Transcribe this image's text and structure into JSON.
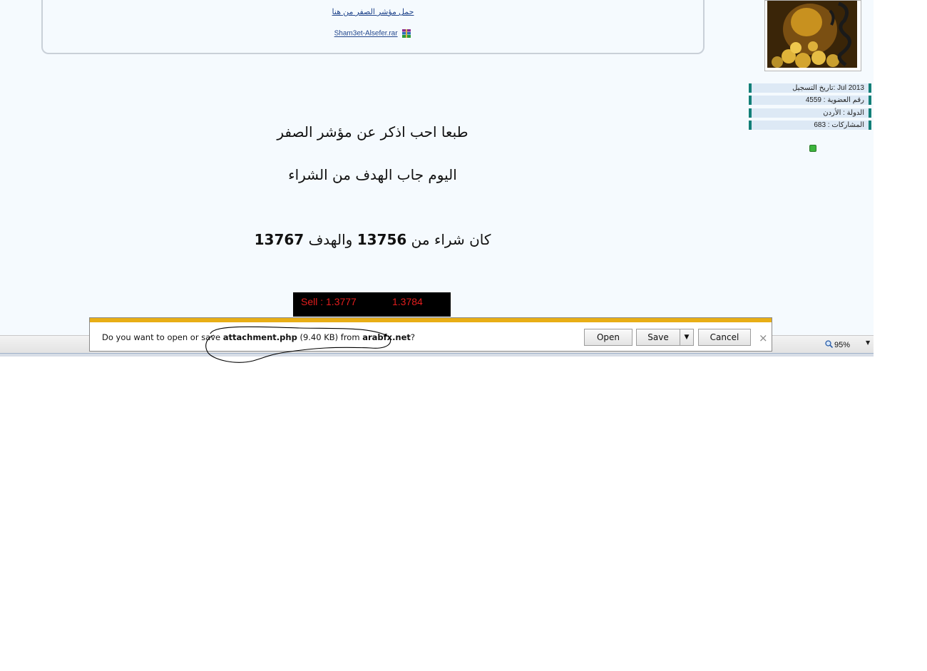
{
  "post": {
    "download_link": "حمل مؤشر الصفر من هنا",
    "attachment_name": "Sham3et-Alsefer.rar",
    "line1": "طبعا احب اذكر عن مؤشر الصفر",
    "line2": "اليوم جاب الهدف من الشراء",
    "line3_prefix": "كان شراء من",
    "line3_buy": "13756",
    "line3_mid": "والهدف",
    "line3_target": "13767"
  },
  "price_ticker": {
    "sell": "Sell :  1.3777",
    "buy": "1.3784"
  },
  "user_info": {
    "join_date": "تاريخ التسجيل: Jul 2013",
    "member_no": "رقم العضوية : 4559",
    "country": "الدولة : الأردن",
    "posts": "المشاركات : 683"
  },
  "statusbar": {
    "zoom": "95%"
  },
  "download_bar": {
    "msg_prefix": "Do you want to open or save ",
    "file": "attachment.php",
    "size": " (9.40 KB) from ",
    "site": "arabfx.net",
    "suffix": "?",
    "open_label": "Open",
    "save_label": "Save",
    "cancel_label": "Cancel",
    "close_glyph": "×"
  },
  "colors": {
    "notification_accent": "#e8ae16",
    "ticker_text": "#e31d1d",
    "info_bar": "#127f78"
  }
}
